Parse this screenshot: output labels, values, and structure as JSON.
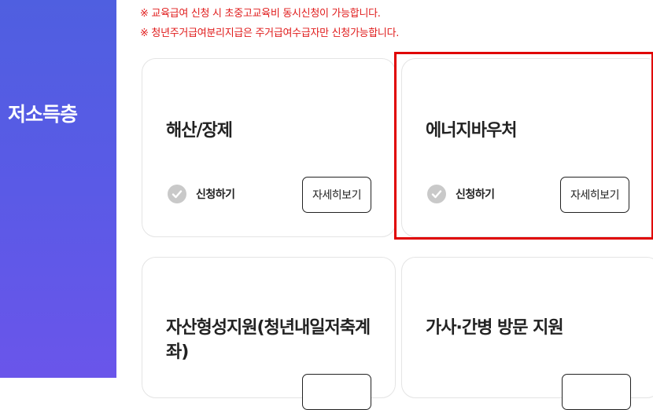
{
  "sidebar": {
    "title": "저소득층"
  },
  "notices": [
    "※ 교육급여 신청 시 초중고교육비 동시신청이 가능합니다.",
    "※ 청년주거급여분리지급은 주거급여수급자만 신청가능합니다."
  ],
  "cards": [
    {
      "title": "해산/장제",
      "apply_label": "신청하기",
      "detail_label": "자세히보기"
    },
    {
      "title": "에너지바우처",
      "apply_label": "신청하기",
      "detail_label": "자세히보기"
    },
    {
      "title": "자산형성지원(청년내일저축계좌)"
    },
    {
      "title": "가사·간병 방문 지원"
    }
  ],
  "colors": {
    "sidebar": "#5a5ae6",
    "notice": "#e01b1b",
    "highlight": "#e00000"
  },
  "icons": {
    "apply": "check-circle-icon"
  }
}
